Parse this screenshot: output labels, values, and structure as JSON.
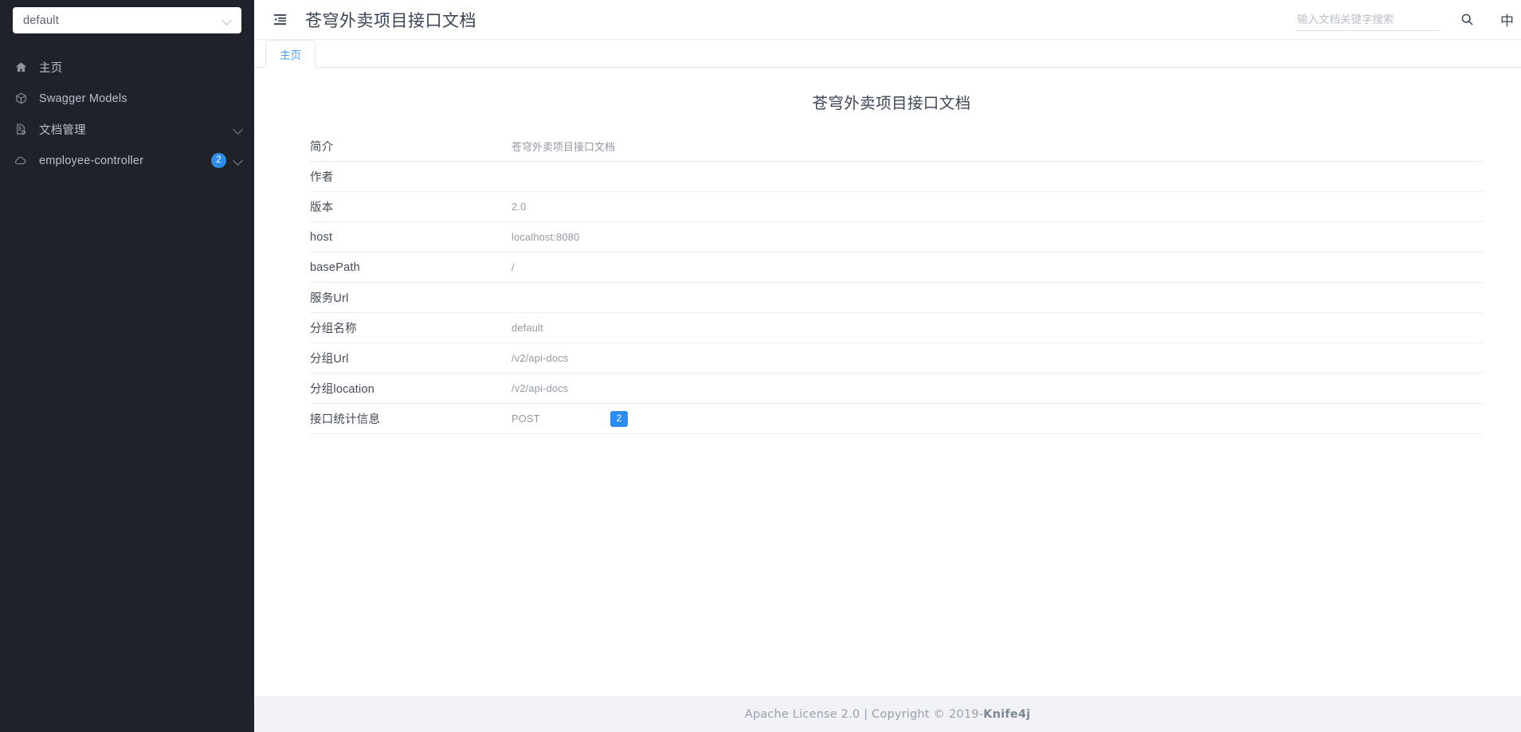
{
  "sidebar": {
    "group_select": {
      "value": "default",
      "icon": "chevron-down-icon"
    },
    "items": [
      {
        "label": "主页",
        "icon": "home-icon",
        "badge": "",
        "chevron": false
      },
      {
        "label": "Swagger Models",
        "icon": "cube-icon",
        "badge": "",
        "chevron": false
      },
      {
        "label": "文档管理",
        "icon": "file-settings-icon",
        "badge": "",
        "chevron": true
      },
      {
        "label": "employee-controller",
        "icon": "cloud-icon",
        "badge": "2",
        "chevron": true
      }
    ]
  },
  "topbar": {
    "fold_icon": "menu-fold-icon",
    "title": "苍穹外卖项目接口文档",
    "search": {
      "placeholder": "输入文档关键字搜索",
      "value": ""
    },
    "search_icon": "search-icon",
    "lang_toggle": "中"
  },
  "tabs": [
    {
      "label": "主页",
      "active": true
    }
  ],
  "main": {
    "doc_title": "苍穹外卖项目接口文档",
    "rows": [
      {
        "key": "简介",
        "value": "苍穹外卖项目接口文档"
      },
      {
        "key": "作者",
        "value": ""
      },
      {
        "key": "版本",
        "value": "2.0"
      },
      {
        "key": "host",
        "value": "localhost:8080"
      },
      {
        "key": "basePath",
        "value": "/"
      },
      {
        "key": "服务Url",
        "value": ""
      },
      {
        "key": "分组名称",
        "value": "default"
      },
      {
        "key": "分组Url",
        "value": "/v2/api-docs"
      },
      {
        "key": "分组location",
        "value": "/v2/api-docs"
      }
    ],
    "stats": {
      "key": "接口统计信息",
      "method": "POST",
      "count": "2"
    }
  },
  "footer": {
    "text_before": "Apache License 2.0 | Copyright © 2019-",
    "brand": "Knife4j"
  },
  "colors": {
    "sidebar_bg": "#1f2329",
    "accent": "#2d8cf0",
    "tab_active": "#409eff",
    "footer_bg": "#f0f2f5"
  }
}
